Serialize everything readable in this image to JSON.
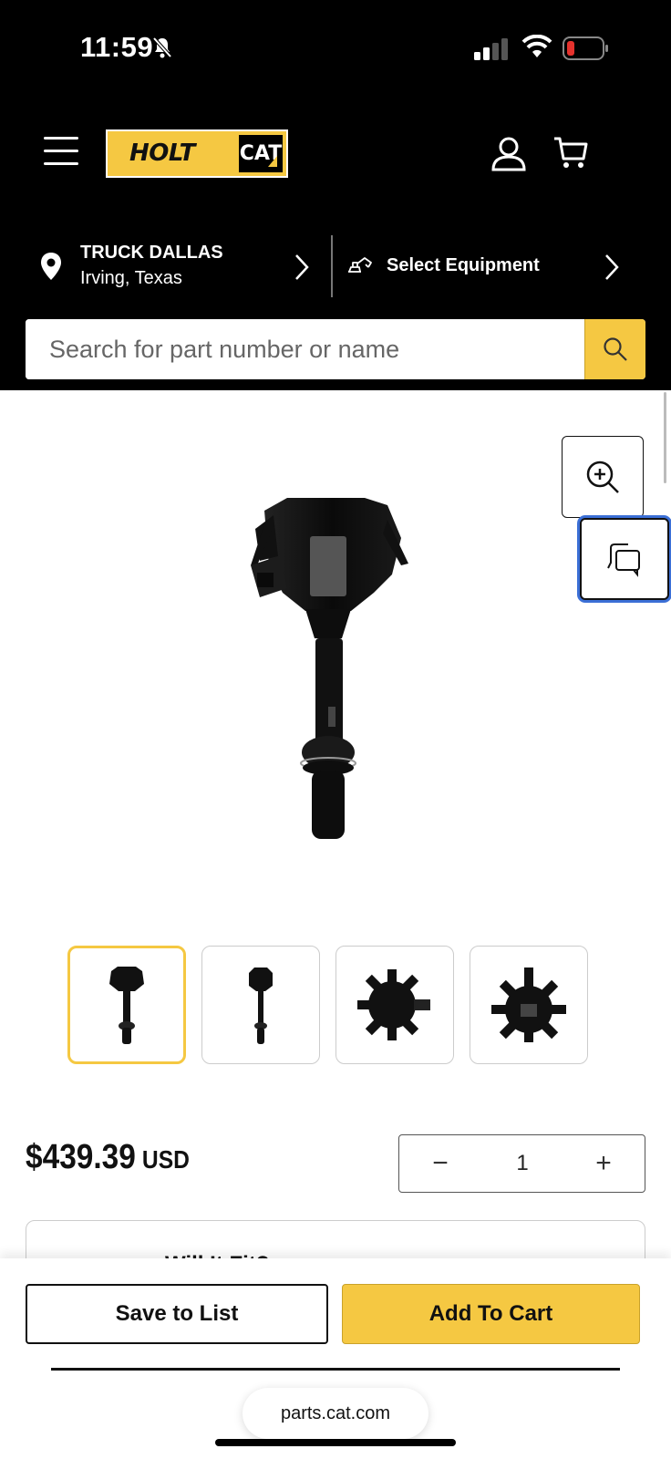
{
  "status_bar": {
    "time": "11:59"
  },
  "header": {
    "logo_text": "HOLT",
    "logo_badge": "CAT"
  },
  "store": {
    "name": "TRUCK DALLAS",
    "city": "Irving, Texas"
  },
  "equipment": {
    "label": "Select Equipment"
  },
  "search": {
    "placeholder": "Search for part number or name"
  },
  "product": {
    "price": "$439.39",
    "currency": "USD",
    "quantity": "1",
    "quantity_minus": "−",
    "quantity_plus": "+",
    "fit_title": "Will It Fit?"
  },
  "actions": {
    "save_label": "Save to List",
    "add_label": "Add To Cart"
  },
  "browser": {
    "url": "parts.cat.com"
  },
  "colors": {
    "accent": "#f5c842",
    "header_bg": "#000000",
    "focus_ring": "#3b6fd6"
  },
  "icons": [
    "bell-slash-icon",
    "signal-icon",
    "wifi-icon",
    "battery-icon",
    "menu-icon",
    "user-icon",
    "cart-icon",
    "location-pin-icon",
    "chevron-right-icon",
    "excavator-icon",
    "search-icon",
    "zoom-in-icon",
    "compare-icon"
  ]
}
